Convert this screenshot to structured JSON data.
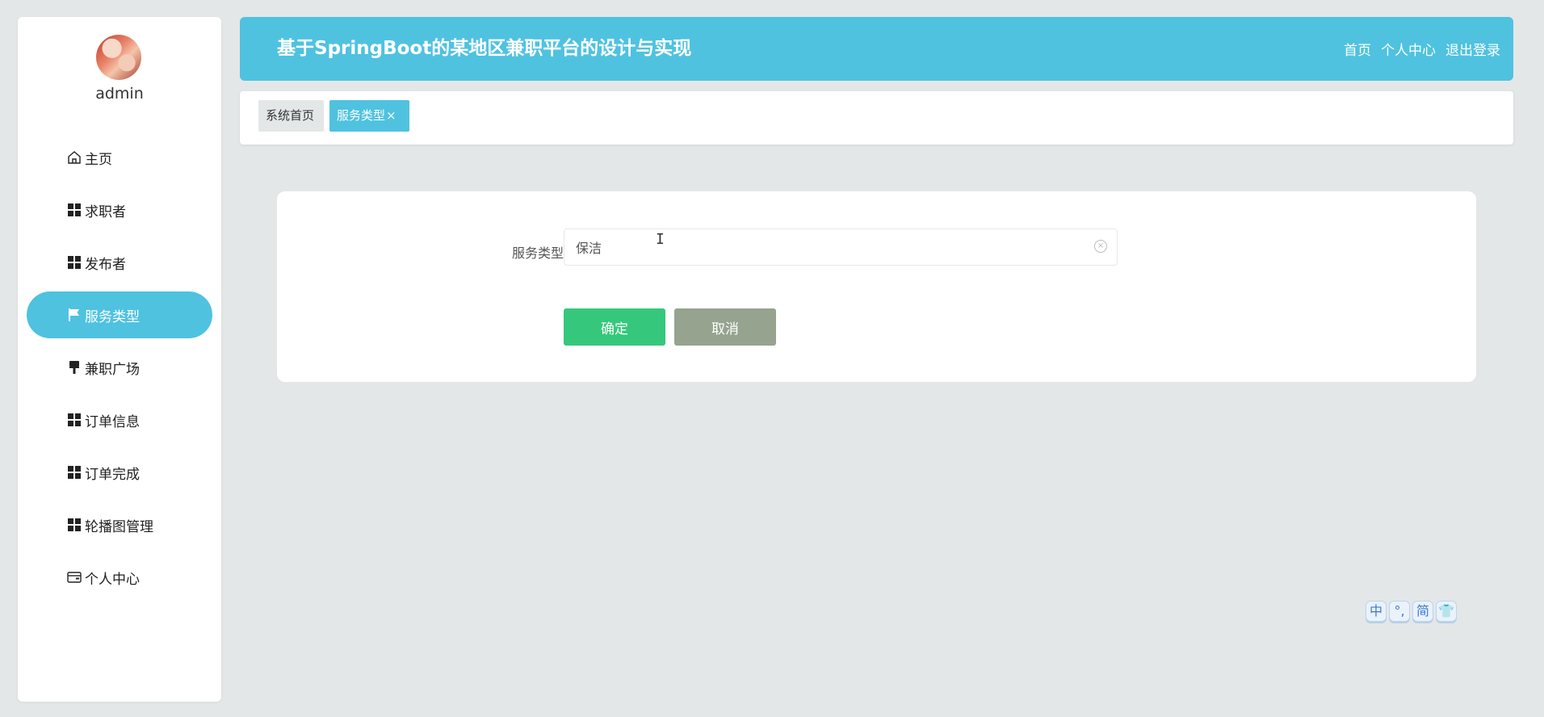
{
  "sidebar": {
    "username": "admin",
    "items": [
      {
        "label": "主页",
        "icon": "home-icon"
      },
      {
        "label": "求职者",
        "icon": "grid-icon"
      },
      {
        "label": "发布者",
        "icon": "grid-icon"
      },
      {
        "label": "服务类型",
        "icon": "flag-icon",
        "active": true
      },
      {
        "label": "兼职广场",
        "icon": "brush-icon"
      },
      {
        "label": "订单信息",
        "icon": "grid-icon"
      },
      {
        "label": "订单完成",
        "icon": "grid-icon"
      },
      {
        "label": "轮播图管理",
        "icon": "grid-icon"
      },
      {
        "label": "个人中心",
        "icon": "wallet-icon"
      }
    ]
  },
  "header": {
    "title": "基于SpringBoot的某地区兼职平台的设计与实现",
    "nav": [
      "首页",
      "个人中心",
      "退出登录"
    ]
  },
  "tabs": [
    {
      "label": "系统首页"
    },
    {
      "label": "服务类型",
      "closable": true,
      "close_glyph": "×"
    }
  ],
  "form": {
    "field_label": "服务类型",
    "field_value": "保洁",
    "confirm_label": "确定",
    "cancel_label": "取消"
  },
  "ime_toolbar": [
    "中",
    "°,",
    "简",
    "👕"
  ],
  "colors": {
    "accent": "#4fc2e0",
    "confirm": "#35c87c",
    "cancel": "#96a38f",
    "background": "#e4e7e7"
  }
}
